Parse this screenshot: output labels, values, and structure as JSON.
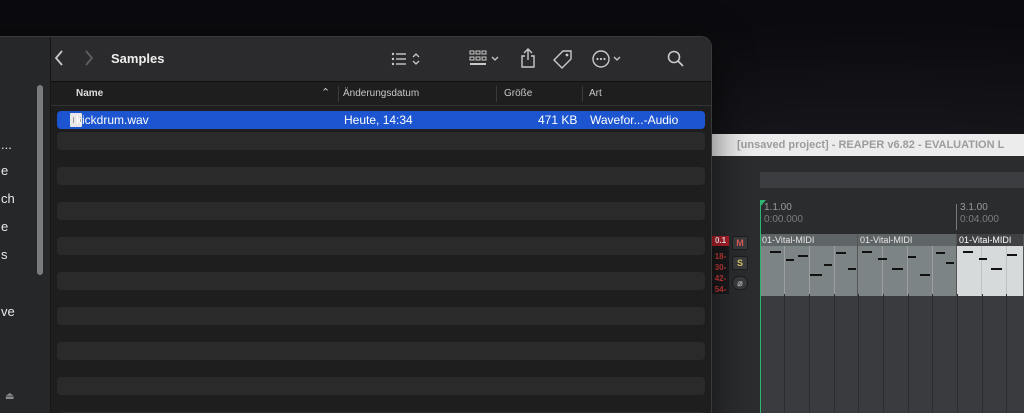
{
  "finder": {
    "title": "Samples",
    "sidebar": {
      "items": [
        {
          "label": "..."
        },
        {
          "label": "e"
        },
        {
          "label": "ch"
        },
        {
          "label": "e"
        },
        {
          "label": "s"
        },
        {
          "label": "ve"
        }
      ]
    },
    "columns": {
      "name": "Name",
      "date": "Änderungsdatum",
      "size": "Größe",
      "kind": "Art"
    },
    "files": [
      {
        "name": "kickdrum.wav",
        "date": "Heute, 14:34",
        "size": "471 KB",
        "kind": "Wavefor...-Audio",
        "selected": true
      }
    ],
    "icons": {
      "back": "chevron-left-icon",
      "forward": "chevron-right-icon",
      "list": "list-view-icon",
      "group": "group-grid-icon",
      "share": "share-icon",
      "tag": "tag-icon",
      "more": "ellipsis-circle-icon",
      "search": "search-icon"
    },
    "colors": {
      "selection": "#1c55cf"
    }
  },
  "reaper": {
    "title": "[unsaved project] - REAPER v6.82 - EVALUATION L",
    "ruler": [
      {
        "bar": "1.1.00",
        "time": "0:00.000"
      },
      {
        "bar": "3.1.00",
        "time": "0:04.000"
      }
    ],
    "track": {
      "peak": "0.1",
      "meter_labels": [
        "18-",
        "30-",
        "42-",
        "54-"
      ],
      "mute_label": "M",
      "solo_label": "S",
      "phase_label": "⌀"
    },
    "clips": [
      {
        "name": "01-Vital-MIDI",
        "selected": false
      },
      {
        "name": "01-Vital-MIDI",
        "selected": false
      },
      {
        "name": "01-Vital-MIDI",
        "selected": true
      }
    ],
    "colors": {
      "playhead": "#2bb673",
      "clip": "#7d8485"
    }
  }
}
